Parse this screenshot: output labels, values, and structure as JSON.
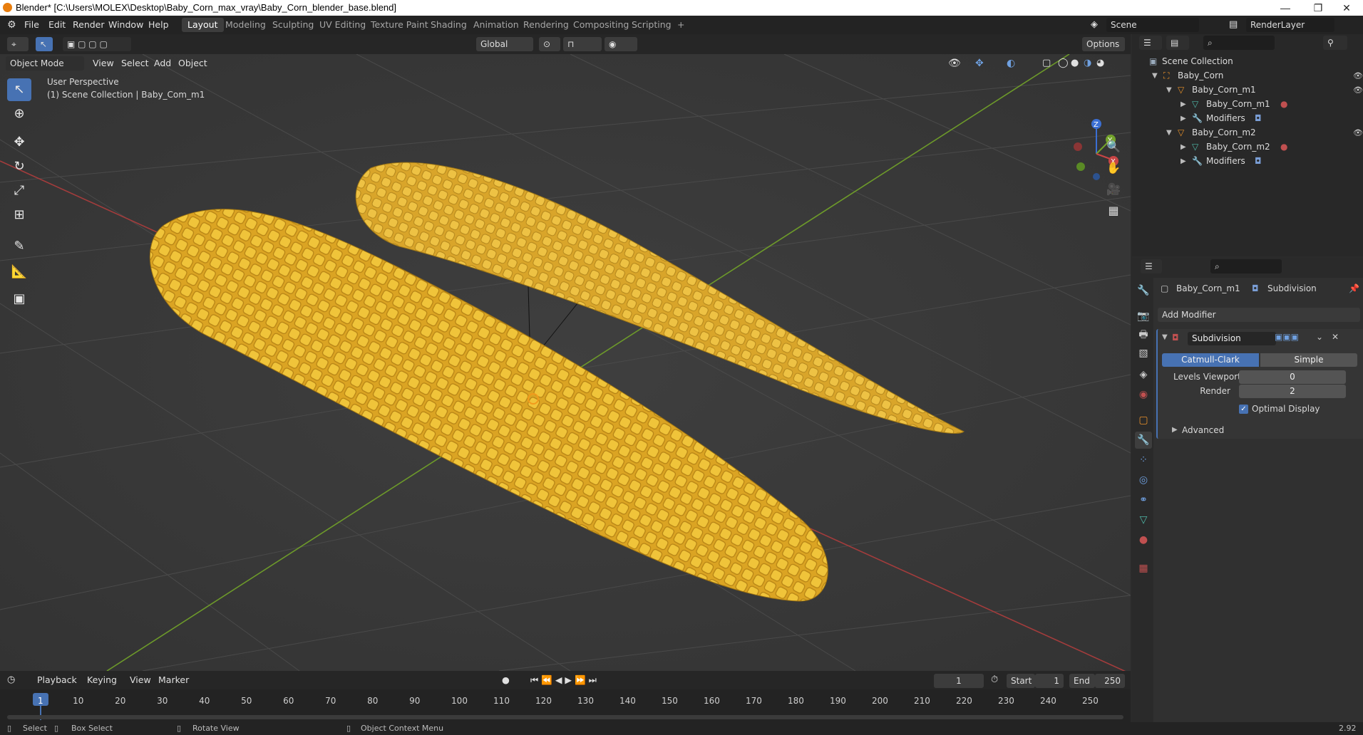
{
  "window": {
    "title": "Blender* [C:\\Users\\MOLEX\\Desktop\\Baby_Corn_max_vray\\Baby_Corn_blender_base.blend]",
    "minimize": "—",
    "restore": "❐",
    "close": "✕"
  },
  "menu": {
    "items": [
      "File",
      "Edit",
      "Render",
      "Window",
      "Help"
    ]
  },
  "workspaces": [
    "Layout",
    "Modeling",
    "Sculpting",
    "UV Editing",
    "Texture Paint",
    "Shading",
    "Animation",
    "Rendering",
    "Compositing",
    "Scripting"
  ],
  "workspace_add": "+",
  "scene": {
    "label": "Scene",
    "render_layer": "RenderLayer"
  },
  "header": {
    "transform_orientation": "Global",
    "options": "Options"
  },
  "viewport": {
    "mode": "Object Mode",
    "menus": [
      "View",
      "Select",
      "Add",
      "Object"
    ],
    "perspective": "User Perspective",
    "collection_info": "(1) Scene Collection | Baby_Com_m1",
    "gizmo": {
      "z": "Z",
      "y": "Y",
      "x": "X"
    }
  },
  "outliner": {
    "root": "Scene Collection",
    "rows": [
      {
        "label": "Baby_Corn",
        "indent": 1
      },
      {
        "label": "Baby_Corn_m1",
        "indent": 2
      },
      {
        "label": "Baby_Corn_m1",
        "indent": 3
      },
      {
        "label": "Modifiers",
        "indent": 3
      },
      {
        "label": "Baby_Corn_m2",
        "indent": 2
      },
      {
        "label": "Baby_Corn_m2",
        "indent": 3
      },
      {
        "label": "Modifiers",
        "indent": 3
      }
    ]
  },
  "properties": {
    "object": "Baby_Corn_m1",
    "modifier_breadcrumb": "Subdivision",
    "add_modifier": "Add Modifier",
    "modifier_name": "Subdivision",
    "catmull": "Catmull-Clark",
    "simple": "Simple",
    "levels_viewport_label": "Levels Viewport",
    "levels_viewport_value": "0",
    "render_label": "Render",
    "render_value": "2",
    "optimal_display": "Optimal Display",
    "advanced": "Advanced"
  },
  "timeline": {
    "menus": [
      "Playback",
      "Keying",
      "View",
      "Marker"
    ],
    "current_frame": "1",
    "start_label": "Start",
    "start_value": "1",
    "end_label": "End",
    "end_value": "250",
    "ticks": [
      "1",
      "10",
      "20",
      "30",
      "40",
      "50",
      "60",
      "70",
      "80",
      "90",
      "100",
      "110",
      "120",
      "130",
      "140",
      "150",
      "160",
      "170",
      "180",
      "190",
      "200",
      "210",
      "220",
      "230",
      "240",
      "250"
    ]
  },
  "status": {
    "select": "Select",
    "box_select": "Box Select",
    "rotate_view": "Rotate View",
    "context_menu": "Object Context Menu",
    "version": "2.92"
  },
  "colors": {
    "accent": "#4772b3",
    "corn": "#e0ad22",
    "axis_x": "#b83c3c",
    "axis_y": "#6e9a2a"
  }
}
